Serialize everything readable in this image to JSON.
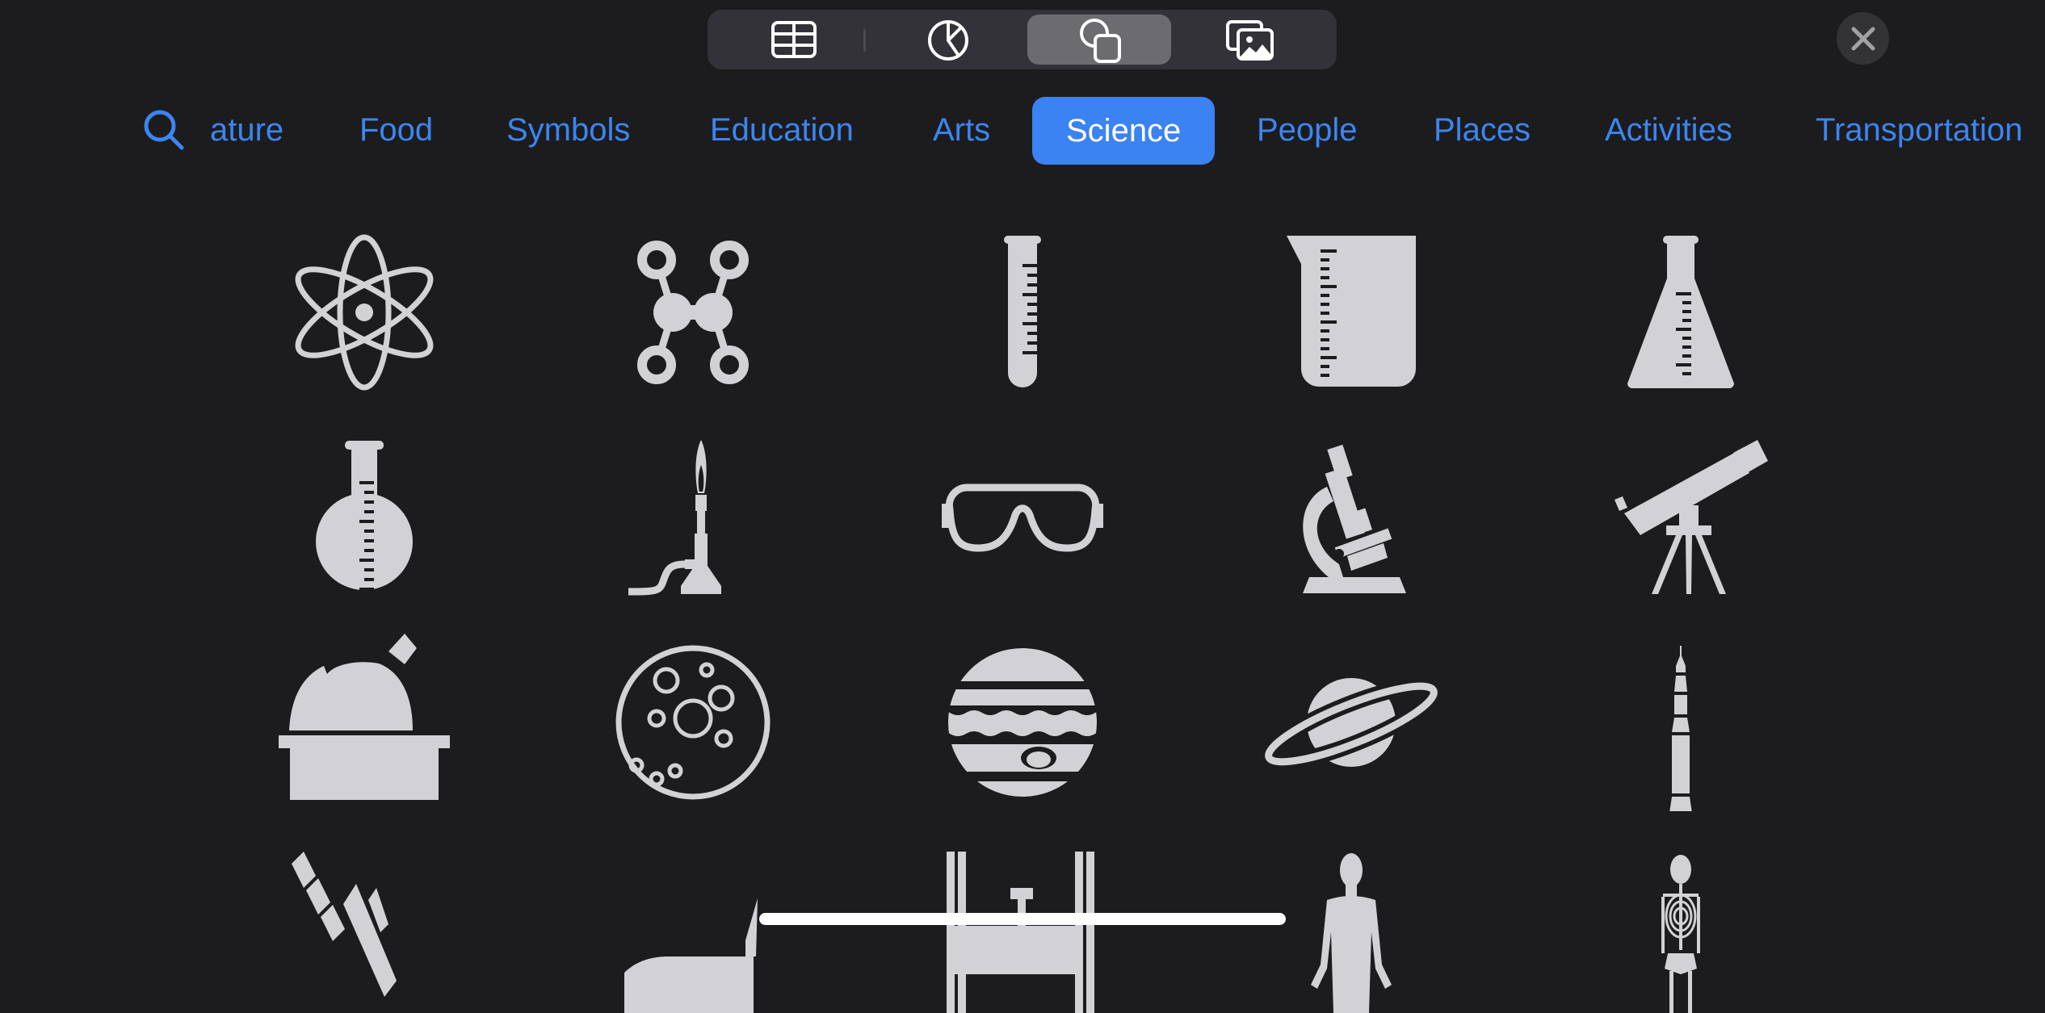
{
  "toolbar": {
    "segments": [
      {
        "name": "table",
        "icon": "table-icon",
        "selected": false
      },
      {
        "name": "chart",
        "icon": "pie-chart-icon",
        "selected": false
      },
      {
        "name": "shapes",
        "icon": "shapes-icon",
        "selected": true
      },
      {
        "name": "media",
        "icon": "photo-stack-icon",
        "selected": false
      }
    ],
    "close_icon": "close-icon"
  },
  "categories": {
    "search_icon": "search-icon",
    "items": [
      {
        "label": "ature",
        "selected": false
      },
      {
        "label": "Food",
        "selected": false
      },
      {
        "label": "Symbols",
        "selected": false
      },
      {
        "label": "Education",
        "selected": false
      },
      {
        "label": "Arts",
        "selected": false
      },
      {
        "label": "Science",
        "selected": true
      },
      {
        "label": "People",
        "selected": false
      },
      {
        "label": "Places",
        "selected": false
      },
      {
        "label": "Activities",
        "selected": false
      },
      {
        "label": "Transportation",
        "selected": false
      }
    ]
  },
  "shapes": [
    [
      "atom",
      "molecule",
      "test-tube",
      "beaker",
      "erlenmeyer-flask"
    ],
    [
      "round-flask",
      "bunsen-burner",
      "safety-goggles",
      "microscope",
      "telescope"
    ],
    [
      "observatory",
      "moon",
      "jupiter",
      "saturn",
      "rocket"
    ],
    [
      "satellite",
      "space-shuttle",
      "space-station",
      "human-body",
      "skeleton"
    ]
  ],
  "colors": {
    "background": "#1c1c1e",
    "accent": "#3d85f0",
    "selected_pill": "#3b82f2",
    "shape_fill": "#d1d1d6",
    "segment_bg": "#323238",
    "segment_selected": "#6c6c70"
  }
}
